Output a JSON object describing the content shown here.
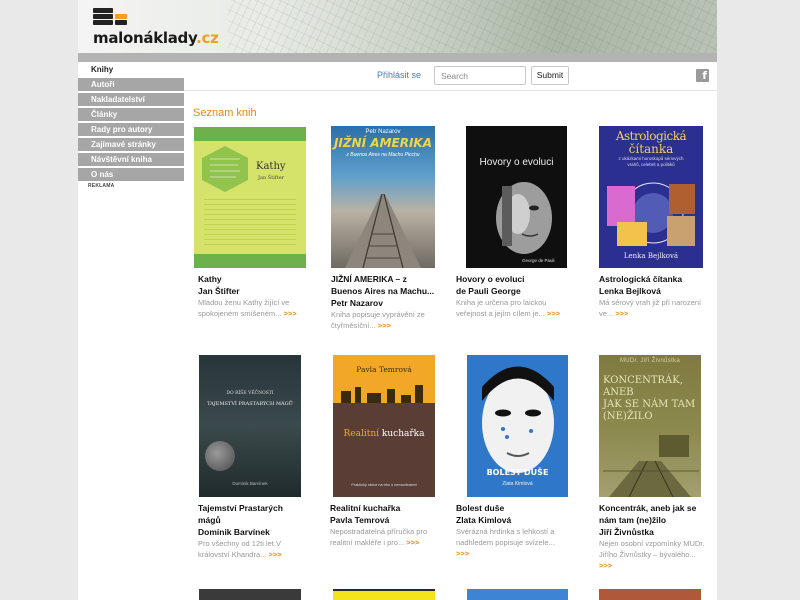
{
  "site": {
    "logo_text": "malonáklady",
    "logo_tld": ".cz"
  },
  "sidebar": {
    "items": [
      {
        "label": "Knihy",
        "active": true
      },
      {
        "label": "Autoři"
      },
      {
        "label": "Nakladatelství"
      },
      {
        "label": "Články"
      },
      {
        "label": "Rady pro autory"
      },
      {
        "label": "Zajímavé stránky"
      },
      {
        "label": "Návštěvní kniha"
      },
      {
        "label": "O nás"
      }
    ],
    "ad_label": "REKLAMA"
  },
  "topbar": {
    "login_label": "Přihlásit se",
    "search_placeholder": "Search",
    "submit_label": "Submit",
    "facebook_icon": "facebook-icon"
  },
  "main": {
    "section_title": "Seznam knih",
    "more_label": ">>>",
    "books": [
      {
        "title": "Kathy",
        "author": "Jan Štifter",
        "desc_1": "Mladou ženu Kathy žijící ve",
        "desc_2": "spokojeném smíšeném...",
        "cover_title": "Kathy",
        "cover_author": "Jan Štifter"
      },
      {
        "title_1": "JIŽNÍ AMERIKA – z",
        "title_2": "Buenos Aires na Machu...",
        "author": "Petr Nazarov",
        "desc_1": "Kniha popisuje vyprávění ze",
        "desc_2": "čtyřměsíční...",
        "cover_author": "Petr Nazarov",
        "cover_title": "JIŽNÍ AMERIKA",
        "cover_subtitle": "z Buenos Aires na Machu Picchu"
      },
      {
        "title_1": "Hovory o evoluci",
        "title_2": "de Pauli George",
        "desc_1": "Kniha je určena pro laickou",
        "desc_2": "veřejnost a jejím cílem je...",
        "cover_title": "Hovory o evoluci",
        "cover_author": "George de Pauli"
      },
      {
        "title": "Astrologická čítanka",
        "author": "Lenka Bejlková",
        "desc_1": "Má sérový vrah již při narození",
        "desc_2": "ve...",
        "cover_title_1": "Astrologická",
        "cover_title_2": "čítanka",
        "cover_subtitle": "z ukázkami horoskopů sériových vrahů, celebrit a politiků",
        "cover_author": "Lenka Bejlková"
      },
      {
        "title_1": "Tajemství Prastarých",
        "title_2": "mágů",
        "author": "Dominik Barvínek",
        "desc_1": "Pro všechny od 12ti let.V",
        "desc_2": "království Khandra...",
        "cover_top": "DO RÍŠE VĚČNOSTI",
        "cover_title": "TAJEMSTVÍ PRASTARÝCH MÁGŮ",
        "cover_author": "Dominik Barvínek"
      },
      {
        "title": "Realitní kuchařka",
        "author": "Pavla Temrová",
        "desc_1": "Nepostradatelná příručka pro",
        "desc_2": "realitní makléře i pro...",
        "cover_author": "Pavla Temrová",
        "cover_title_a": "Realitní ",
        "cover_title_b": "kuchařka",
        "cover_subtitle": "Praktický rádce na trhu s nemovitostmi"
      },
      {
        "title": "Bolest duše",
        "author": "Zlata Kimlová",
        "desc_1": "Svérázná hrdinka s lehkostí a",
        "desc_2": "nadhledem popisuje svízele...",
        "cover_title": "BOLEST DUŠE",
        "cover_author": "Zlata Kimlová"
      },
      {
        "title_1": "Koncentrák, aneb jak se",
        "title_2": "nám tam (ne)žilo",
        "author": "Jiří Živnůstka",
        "desc_1": "Nejen osobní vzpomínky MUDr.",
        "desc_2": "Jiřího Živnůstky – bývalého...",
        "cover_author": "MUDr. Jiří Živnůstka",
        "cover_title_1": "KONCENTRÁK,",
        "cover_title_2": "ANEB",
        "cover_title_3": "JAK SE NÁM TAM",
        "cover_title_4": "(NE)ŽILO"
      }
    ]
  },
  "colors": {
    "accent": "#e8860d",
    "link": "#3d7ec9",
    "nav_bg": "#a6a6a6"
  }
}
